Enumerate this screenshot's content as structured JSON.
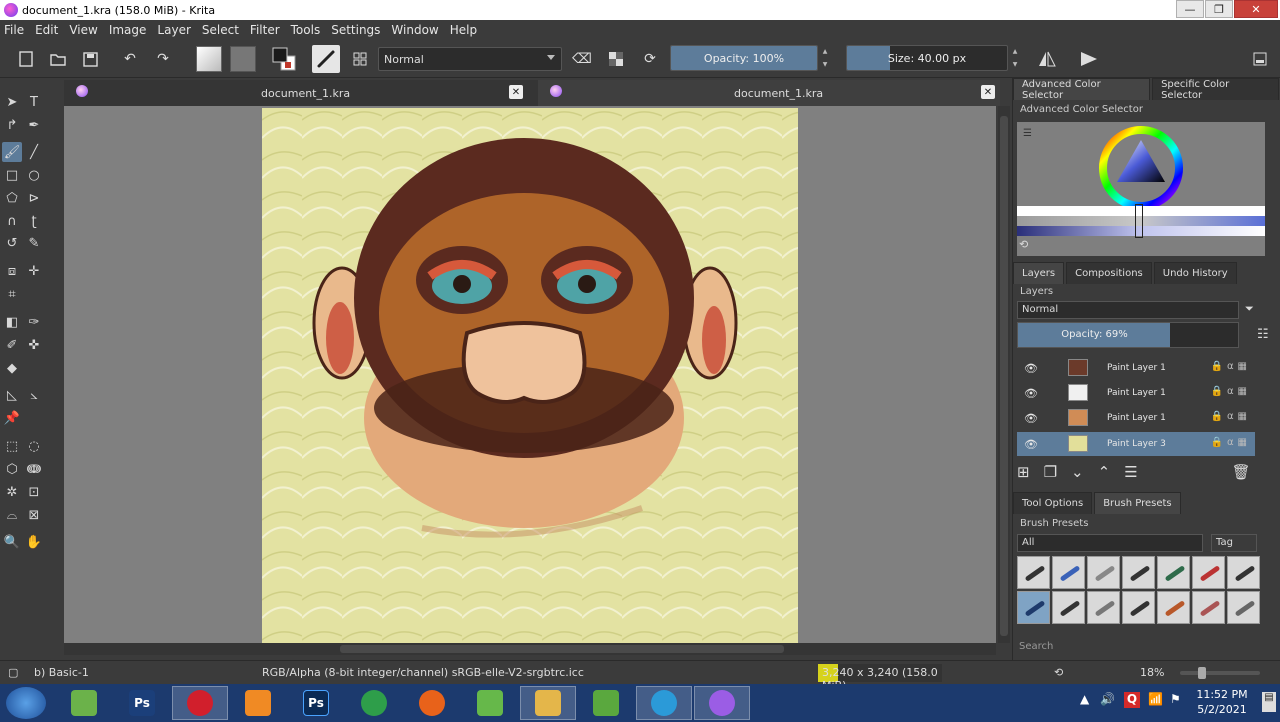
{
  "window": {
    "title": "document_1.kra (158.0 MiB) - Krita",
    "minimize": "—",
    "restore": "❐",
    "close": "✕"
  },
  "menu": [
    "File",
    "Edit",
    "View",
    "Image",
    "Layer",
    "Select",
    "Filter",
    "Tools",
    "Settings",
    "Window",
    "Help"
  ],
  "toolbar": {
    "blend_mode": "Normal",
    "opacity_label": "Opacity: 100%",
    "opacity_value": 1.0,
    "size_label": "Size: 40.00 px",
    "size_value": 0.27
  },
  "document_tabs": [
    {
      "name": "document_1.kra",
      "close": "✕"
    },
    {
      "name": "document_1.kra",
      "close": "✕"
    }
  ],
  "docker": {
    "color_tabs": [
      "Advanced Color Selector",
      "Specific Color Selector"
    ],
    "color_title": "Advanced Color Selector",
    "layer_tabs": [
      "Layers",
      "Compositions",
      "Undo History"
    ],
    "layers_title": "Layers",
    "layers_blend": "Normal",
    "layers_opacity_label": "Opacity:  69%",
    "layers_opacity_value": 0.69,
    "layers": [
      {
        "name": "Paint Layer 1",
        "selected": false,
        "thumb": "#6b3a2a"
      },
      {
        "name": "Paint Layer 1",
        "selected": false,
        "thumb": "#f0f0f0"
      },
      {
        "name": "Paint Layer 1",
        "selected": false,
        "thumb": "#d08c56"
      },
      {
        "name": "Paint Layer 3",
        "selected": true,
        "thumb": "#e2df9a"
      }
    ],
    "bottom_tabs": [
      "Tool Options",
      "Brush Presets"
    ],
    "brush_title": "Brush Presets",
    "brush_filter": "All",
    "brush_tag": "Tag",
    "search_placeholder": "Search"
  },
  "status": {
    "brush": "b) Basic-1",
    "color_space": "RGB/Alpha (8-bit integer/channel)  sRGB-elle-V2-srgbtrc.icc",
    "image_info": "3,240 x 3,240 (158.0 MiB)",
    "zoom": "18%"
  },
  "taskbar": {
    "time": "11:52 PM",
    "date": "5/2/2021",
    "apps": [
      {
        "name": "krita-green",
        "label": "",
        "color": "#6bb24a"
      },
      {
        "name": "photoshop",
        "label": "Ps",
        "color": "#1b3f7a"
      },
      {
        "name": "opera",
        "label": "",
        "color": "#d11f2c"
      },
      {
        "name": "media-player",
        "label": "",
        "color": "#f08a24"
      },
      {
        "name": "photoshop-2",
        "label": "Ps",
        "color": "#0b2a55"
      },
      {
        "name": "chrome",
        "label": "",
        "color": "#2e9e4a"
      },
      {
        "name": "firefox",
        "label": "",
        "color": "#e8621a"
      },
      {
        "name": "krita-green-2",
        "label": "",
        "color": "#66b84a"
      },
      {
        "name": "file-explorer",
        "label": "",
        "color": "#e4b64a"
      },
      {
        "name": "krita-green-3",
        "label": "",
        "color": "#5aa83e"
      },
      {
        "name": "telegram",
        "label": "",
        "color": "#2b9ad8"
      },
      {
        "name": "krita",
        "label": "",
        "color": "#9b5de5"
      }
    ]
  }
}
